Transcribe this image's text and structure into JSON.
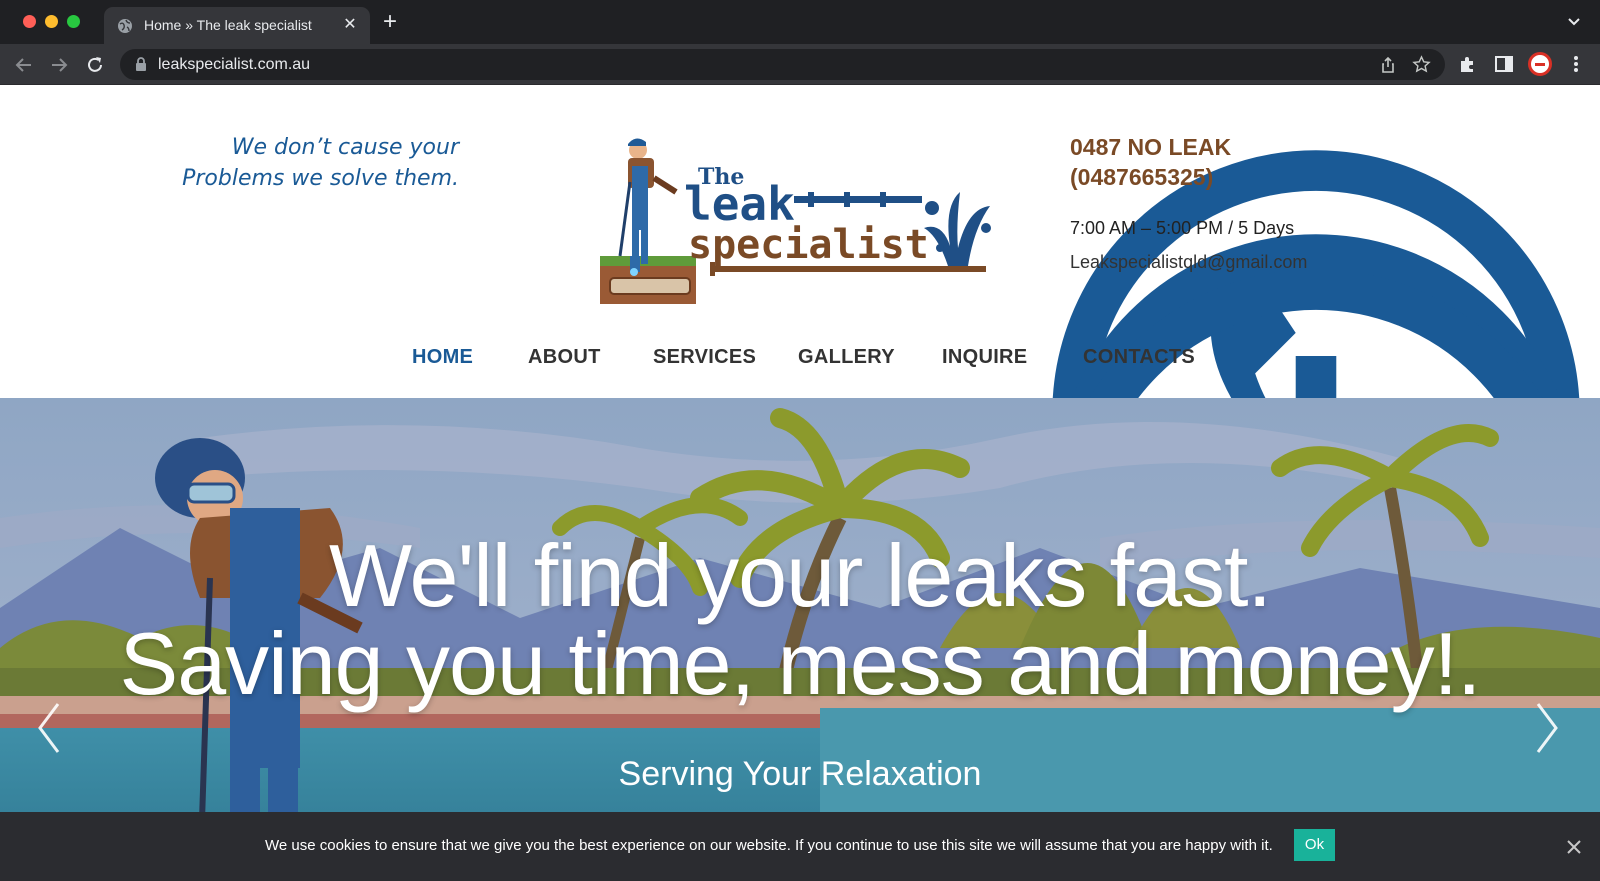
{
  "browser": {
    "tab_title": "Home » The leak specialist",
    "tab_close": "✕",
    "new_tab": "+",
    "url": "leakspecialist.com.au"
  },
  "header": {
    "tagline_line1": "We don’t cause your",
    "tagline_line2": "Problems we solve them.",
    "logo": {
      "word_the": "The",
      "word_leak": "leak",
      "word_specialist": "specialist"
    },
    "phone_line1": "0487 NO LEAK",
    "phone_line2": "(0487665325)",
    "hours": "7:00 AM – 5:00 PM / 5 Days",
    "email": "Leakspecialistqld@gmail.com"
  },
  "nav": {
    "items": [
      {
        "label": "HOME",
        "active": true
      },
      {
        "label": "ABOUT",
        "active": false
      },
      {
        "label": "SERVICES",
        "active": false
      },
      {
        "label": "GALLERY",
        "active": false
      },
      {
        "label": "INQUIRE",
        "active": false
      },
      {
        "label": "CONTACTS",
        "active": false
      }
    ]
  },
  "hero": {
    "headline_line1": "We'll find your leaks fast.",
    "headline_line2": "Saving you time, mess and money!.",
    "subtitle": "Serving Your Relaxation"
  },
  "cookie": {
    "message": "We use cookies to ensure that we give you the best experience on our website. If you continue to use this site we will assume that you are happy with it.",
    "ok_label": "Ok"
  },
  "colors": {
    "brand_blue": "#1a5a96",
    "brand_brown": "#7a4a26",
    "cookie_ok": "#19b29a"
  }
}
